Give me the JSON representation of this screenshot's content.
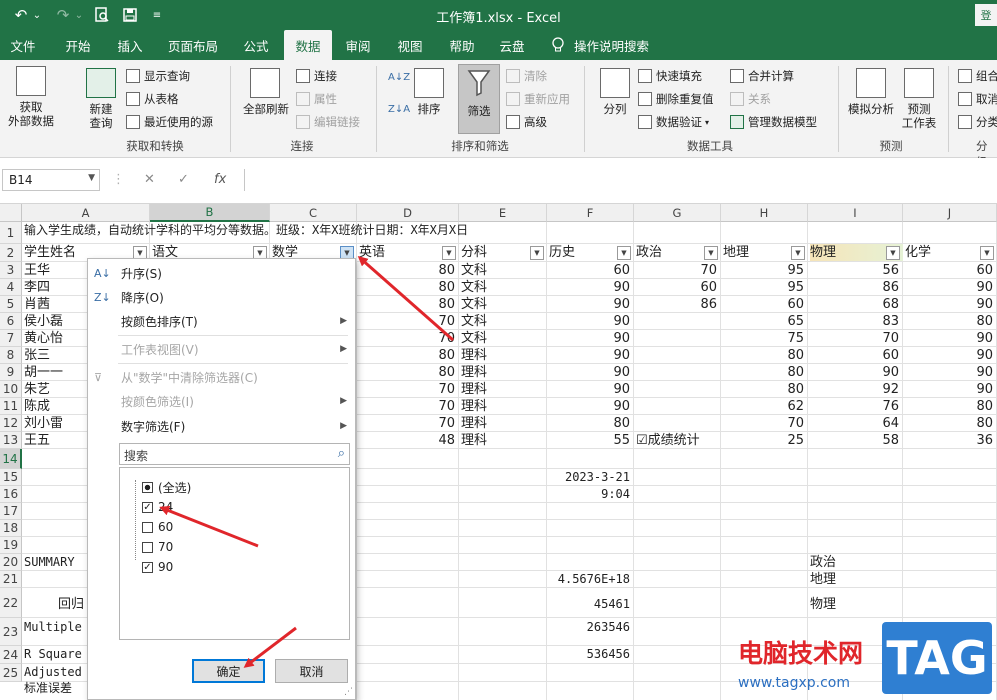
{
  "titlebar": {
    "undo": "↶",
    "undo_dd": "⌄",
    "redo": "↷",
    "redo_dd": "⌄",
    "title": "工作簿1.xlsx  -  Excel",
    "login": "登"
  },
  "tabs": [
    "文件",
    "开始",
    "插入",
    "页面布局",
    "公式",
    "数据",
    "审阅",
    "视图",
    "帮助",
    "云盘",
    "操作说明搜索"
  ],
  "ribbon": {
    "get_data": "获取\n外部数据",
    "new_query": "新建\n查询",
    "show_query": "显示查询",
    "from_table": "从表格",
    "recent_sources": "最近使用的源",
    "group_get": "获取和转换",
    "refresh_all": "全部刷新",
    "connections": "连接",
    "properties": "属性",
    "edit_links": "编辑链接",
    "group_conn": "连接",
    "sort": "排序",
    "filter": "筛选",
    "clear": "清除",
    "reapply": "重新应用",
    "advanced": "高级",
    "group_sort": "排序和筛选",
    "split": "分列",
    "flash_fill": "快速填充",
    "remove_dup": "删除重复值",
    "validation": "数据验证",
    "consolidate": "合并计算",
    "relations": "关系",
    "data_model": "管理数据模型",
    "group_tools": "数据工具",
    "whatif": "模拟分析",
    "forecast": "预测\n工作表",
    "group_forecast": "预测",
    "group_c": "组合",
    "ungroup_c": "取消",
    "subtotal_c": "分类",
    "group_outline": "分级"
  },
  "formula_bar": {
    "name_box": "B14",
    "cancel": "✕",
    "enter": "✓",
    "fx": "fx",
    "value": ""
  },
  "columns": [
    "A",
    "B",
    "C",
    "D",
    "E",
    "F",
    "G",
    "H",
    "I",
    "J"
  ],
  "rows": [
    "1",
    "2",
    "3",
    "4",
    "5",
    "6",
    "7",
    "8",
    "9",
    "10",
    "11",
    "12",
    "13",
    "14",
    "15",
    "16",
    "17",
    "18",
    "19",
    "20",
    "21",
    "22",
    "23",
    "24",
    "25"
  ],
  "sheet": {
    "r1": "输入学生成绩，自动统计学科的平均分等数据。班级：X年X班统计日期：X年X月X日",
    "headers": [
      "学生姓名",
      "语文",
      "数学",
      "英语",
      "分科",
      "历史",
      "政治",
      "地理",
      "物理",
      "化学"
    ],
    "students": [
      {
        "name": "王华",
        "en": "80",
        "type": "文科",
        "hist": "60",
        "pol": "70",
        "geo": "95",
        "phy": "56",
        "chem": "60"
      },
      {
        "name": "李四",
        "en": "80",
        "type": "文科",
        "hist": "90",
        "pol": "60",
        "geo": "95",
        "phy": "86",
        "chem": "90"
      },
      {
        "name": "肖茜",
        "en": "80",
        "type": "文科",
        "hist": "90",
        "pol": "86",
        "geo": "60",
        "phy": "68",
        "chem": "90"
      },
      {
        "name": "侯小磊",
        "en": "70",
        "type": "文科",
        "hist": "90",
        "pol": "",
        "geo": "65",
        "phy": "83",
        "chem": "80"
      },
      {
        "name": "黄心怡",
        "en": "70",
        "type": "文科",
        "hist": "90",
        "pol": "",
        "geo": "75",
        "phy": "70",
        "chem": "90"
      },
      {
        "name": "张三",
        "en": "80",
        "type": "理科",
        "hist": "90",
        "pol": "",
        "geo": "80",
        "phy": "60",
        "chem": "90"
      },
      {
        "name": "胡一一",
        "en": "80",
        "type": "理科",
        "hist": "90",
        "pol": "",
        "geo": "80",
        "phy": "90",
        "chem": "90"
      },
      {
        "name": "朱艺",
        "en": "70",
        "type": "理科",
        "hist": "90",
        "pol": "",
        "geo": "80",
        "phy": "92",
        "chem": "90"
      },
      {
        "name": "陈成",
        "en": "70",
        "type": "理科",
        "hist": "90",
        "pol": "",
        "geo": "62",
        "phy": "76",
        "chem": "80"
      },
      {
        "name": "刘小雷",
        "en": "70",
        "type": "理科",
        "hist": "80",
        "pol": "",
        "geo": "70",
        "phy": "64",
        "chem": "80"
      },
      {
        "name": "王五",
        "en": "48",
        "type": "理科",
        "hist": "55",
        "pol": "☑成绩统计",
        "geo": "25",
        "phy": "58",
        "chem": "36"
      }
    ],
    "f15": "2023-3-21",
    "f16": "9:04",
    "a20": "SUMMARY",
    "i20": "政治",
    "f21": "4.5676E+18",
    "i21": "地理",
    "a22": "回归",
    "f22": "45461",
    "i22": "物理",
    "a23": "Multiple",
    "f23": "263546",
    "a24": "R Square",
    "f24": "536456",
    "a25": "Adjusted",
    "a26": "标准误差"
  },
  "dropdown": {
    "sort_asc": "升序(S)",
    "sort_desc": "降序(O)",
    "sort_color": "按颜色排序(T)",
    "sheet_view": "工作表视图(V)",
    "clear_filter": "从\"数学\"中清除筛选器(C)",
    "filter_color": "按颜色筛选(I)",
    "number_filter": "数字筛选(F)",
    "search_placeholder": "搜索",
    "items": [
      {
        "label": "(全选)",
        "state": "partial"
      },
      {
        "label": "24",
        "state": "checked"
      },
      {
        "label": "60",
        "state": "unchecked"
      },
      {
        "label": "70",
        "state": "unchecked"
      },
      {
        "label": "90",
        "state": "checked"
      }
    ],
    "ok": "确定",
    "cancel": "取消"
  },
  "watermark": {
    "site": "电脑技术网",
    "url": "www.tagxp.com",
    "tag": "TAG"
  },
  "colors": {
    "excel_green": "#217346",
    "arrow_red": "#e0262b",
    "focus_blue": "#0078d7"
  }
}
